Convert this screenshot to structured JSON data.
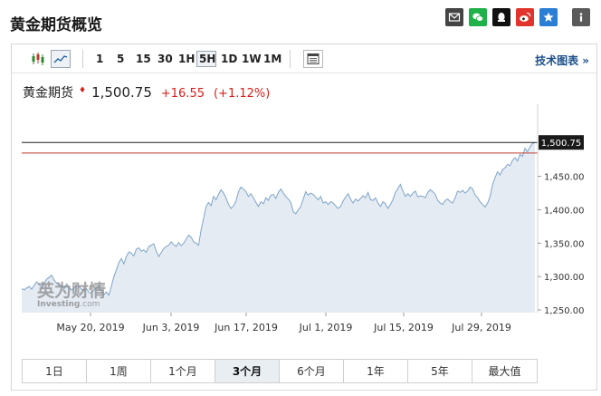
{
  "page": {
    "title": "黄金期货概览"
  },
  "share": {
    "icons": [
      "mail-icon",
      "wechat-icon",
      "qq-icon",
      "weibo-icon",
      "qzone-icon",
      "info-icon"
    ],
    "colors": {
      "mail": "#444444",
      "wechat": "#20b14a",
      "qq": "#111111",
      "weibo": "#e0342d",
      "qzone": "#2a7fd4",
      "info": "#5a5a5a"
    }
  },
  "toolbar": {
    "chart_type_icons": [
      "candlestick-icon",
      "line-chart-icon"
    ],
    "active_chart_type": "line-chart-icon",
    "intervals": [
      "1",
      "5",
      "15",
      "30",
      "1H",
      "5H",
      "1D",
      "1W",
      "1M"
    ],
    "active_interval": "5H",
    "calendar_icon": "calendar-icon",
    "tech_chart_link": "技术图表 »"
  },
  "quote": {
    "name": "黄金期货",
    "arrow": "♦",
    "price": "1,500.75",
    "change": "+16.55",
    "change_pct": "(+1.12%)",
    "colors": {
      "up": "#d91e18"
    }
  },
  "watermark": {
    "cn": "英为财情",
    "en": "Investing",
    "en_suffix": ".com"
  },
  "chart_data": {
    "type": "area",
    "title": "",
    "xlabel": "",
    "ylabel": "",
    "x_tick_labels": [
      "May 20, 2019",
      "Jun 3, 2019",
      "Jun 17, 2019",
      "Jul 1, 2019",
      "Jul 15, 2019",
      "Jul 29, 2019"
    ],
    "y_ticks": [
      1250,
      1300,
      1350,
      1400,
      1450
    ],
    "y_tick_labels": [
      "1,250.00",
      "1,300.00",
      "1,350.00",
      "1,400.00",
      "1,450.00"
    ],
    "ylim": [
      1246,
      1558
    ],
    "last_value": 1500.75,
    "last_value_label": "1,500.75",
    "reference_line": 1485,
    "grid": false,
    "line_color": "#7fa4c7",
    "fill_color": "#e4ebf3",
    "series": [
      {
        "values": [
          1282,
          1280,
          1283,
          1285,
          1281,
          1287,
          1292,
          1288,
          1284,
          1290,
          1296,
          1299,
          1302,
          1295,
          1290,
          1288,
          1286,
          1282,
          1289,
          1284,
          1280,
          1283,
          1287,
          1285,
          1281,
          1279,
          1282,
          1276,
          1275,
          1280,
          1283,
          1286,
          1278,
          1273,
          1277,
          1272,
          1286,
          1300,
          1310,
          1321,
          1327,
          1319,
          1330,
          1337,
          1335,
          1331,
          1341,
          1343,
          1338,
          1340,
          1336,
          1345,
          1347,
          1349,
          1338,
          1330,
          1336,
          1342,
          1345,
          1347,
          1352,
          1348,
          1345,
          1351,
          1346,
          1350,
          1356,
          1362,
          1359,
          1352,
          1350,
          1347,
          1370,
          1387,
          1405,
          1411,
          1406,
          1420,
          1415,
          1423,
          1430,
          1425,
          1418,
          1408,
          1402,
          1406,
          1413,
          1427,
          1434,
          1431,
          1427,
          1420,
          1424,
          1418,
          1411,
          1405,
          1412,
          1409,
          1418,
          1414,
          1422,
          1423,
          1417,
          1426,
          1431,
          1425,
          1420,
          1416,
          1411,
          1397,
          1394,
          1400,
          1405,
          1416,
          1427,
          1422,
          1425,
          1423,
          1419,
          1415,
          1420,
          1410,
          1412,
          1408,
          1412,
          1410,
          1406,
          1402,
          1405,
          1413,
          1419,
          1424,
          1416,
          1410,
          1416,
          1413,
          1417,
          1421,
          1418,
          1426,
          1415,
          1414,
          1418,
          1410,
          1405,
          1412,
          1409,
          1402,
          1408,
          1415,
          1426,
          1432,
          1438,
          1428,
          1420,
          1424,
          1420,
          1425,
          1428,
          1419,
          1421,
          1420,
          1418,
          1426,
          1430,
          1427,
          1423,
          1414,
          1410,
          1408,
          1414,
          1416,
          1412,
          1410,
          1418,
          1428,
          1426,
          1429,
          1425,
          1428,
          1434,
          1431,
          1422,
          1418,
          1412,
          1408,
          1404,
          1410,
          1420,
          1438,
          1448,
          1457,
          1452,
          1460,
          1463,
          1468,
          1466,
          1474,
          1478,
          1473,
          1483,
          1480,
          1492,
          1487,
          1494,
          1499,
          1500.75
        ]
      }
    ]
  },
  "ranges": {
    "items": [
      "1日",
      "1周",
      "1个月",
      "3个月",
      "6个月",
      "1年",
      "5年",
      "最大值"
    ],
    "active": "3个月"
  }
}
